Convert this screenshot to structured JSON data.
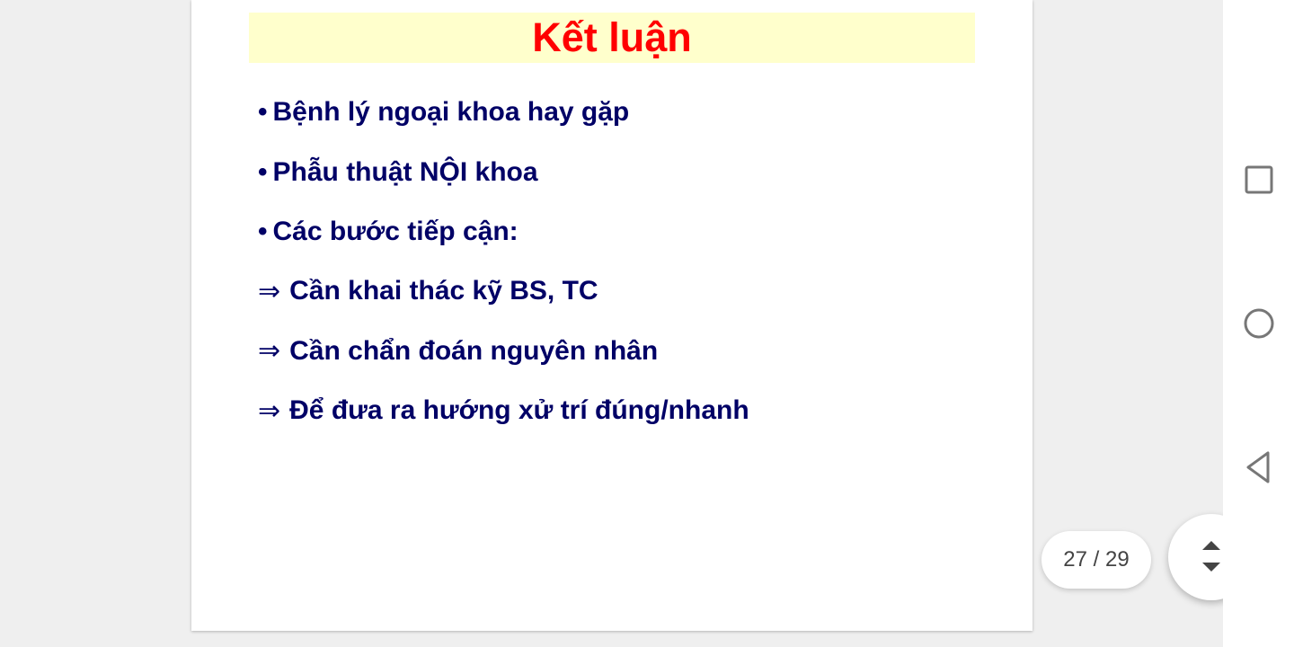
{
  "slide": {
    "title": "Kết luận",
    "lines": [
      {
        "marker": "•",
        "type": "bullet",
        "text": "Bệnh lý ngoại khoa hay gặp"
      },
      {
        "marker": "•",
        "type": "bullet",
        "text": "Phẫu thuật NỘI khoa"
      },
      {
        "marker": "•",
        "type": "bullet",
        "text": "Các bước tiếp cận:"
      },
      {
        "marker": "⇒",
        "type": "arrow",
        "text": "Cần khai thác kỹ BS, TC"
      },
      {
        "marker": "⇒",
        "type": "arrow",
        "text": "Cần chẩn đoán nguyên nhân"
      },
      {
        "marker": "⇒",
        "type": "arrow",
        "text": "Để đưa ra hướng xử trí đúng/nhanh"
      }
    ]
  },
  "viewer": {
    "page_indicator": "27 / 29",
    "scroll_button_icon": "scroll-up-down-icon"
  },
  "navbar": {
    "icons": [
      "recents-square-icon",
      "home-circle-icon",
      "back-triangle-icon"
    ]
  },
  "colors": {
    "title": "#ff0000",
    "title_band": "#ffffcc",
    "body_text": "#000066"
  }
}
